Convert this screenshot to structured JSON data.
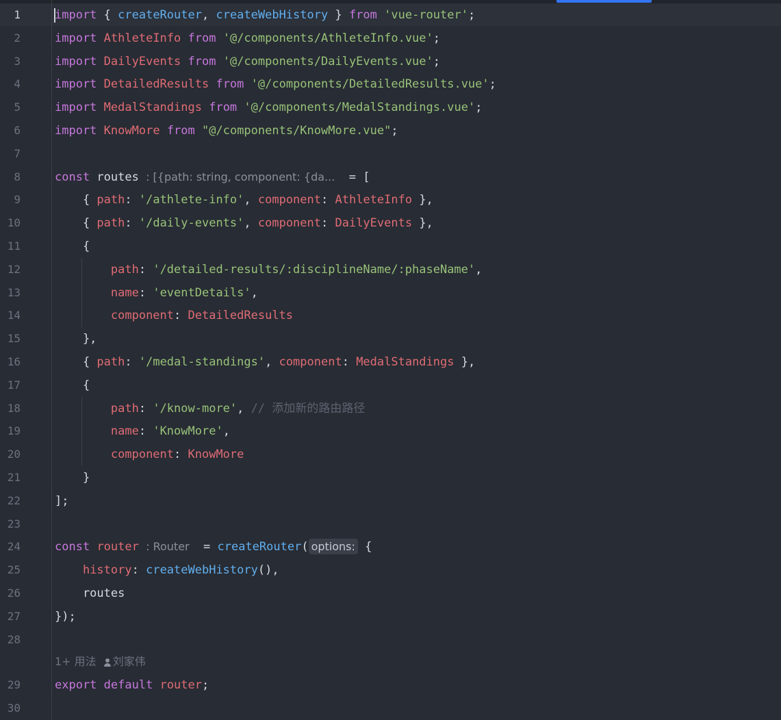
{
  "editor": {
    "lines": [
      {
        "n": "1",
        "tokens": [
          [
            "kw",
            "import"
          ],
          [
            "pun",
            " { "
          ],
          [
            "fn",
            "createRouter"
          ],
          [
            "pun",
            ", "
          ],
          [
            "fn",
            "createWebHistory"
          ],
          [
            "pun",
            " } "
          ],
          [
            "kw",
            "from"
          ],
          [
            "pun",
            " "
          ],
          [
            "str",
            "'vue-router'"
          ],
          [
            "pun",
            ";"
          ]
        ]
      },
      {
        "n": "2",
        "tokens": [
          [
            "kw",
            "import"
          ],
          [
            "pun",
            " "
          ],
          [
            "cls",
            "AthleteInfo"
          ],
          [
            "pun",
            " "
          ],
          [
            "kw",
            "from"
          ],
          [
            "pun",
            " "
          ],
          [
            "str",
            "'@/components/AthleteInfo.vue'"
          ],
          [
            "pun",
            ";"
          ]
        ]
      },
      {
        "n": "3",
        "tokens": [
          [
            "kw",
            "import"
          ],
          [
            "pun",
            " "
          ],
          [
            "cls",
            "DailyEvents"
          ],
          [
            "pun",
            " "
          ],
          [
            "kw",
            "from"
          ],
          [
            "pun",
            " "
          ],
          [
            "str",
            "'@/components/DailyEvents.vue'"
          ],
          [
            "pun",
            ";"
          ]
        ]
      },
      {
        "n": "4",
        "tokens": [
          [
            "kw",
            "import"
          ],
          [
            "pun",
            " "
          ],
          [
            "cls",
            "DetailedResults"
          ],
          [
            "pun",
            " "
          ],
          [
            "kw",
            "from"
          ],
          [
            "pun",
            " "
          ],
          [
            "str",
            "'@/components/DetailedResults.vue'"
          ],
          [
            "pun",
            ";"
          ]
        ]
      },
      {
        "n": "5",
        "tokens": [
          [
            "kw",
            "import"
          ],
          [
            "pun",
            " "
          ],
          [
            "cls",
            "MedalStandings"
          ],
          [
            "pun",
            " "
          ],
          [
            "kw",
            "from"
          ],
          [
            "pun",
            " "
          ],
          [
            "str",
            "'@/components/MedalStandings.vue'"
          ],
          [
            "pun",
            ";"
          ]
        ]
      },
      {
        "n": "6",
        "tokens": [
          [
            "kw",
            "import"
          ],
          [
            "pun",
            " "
          ],
          [
            "cls",
            "KnowMore"
          ],
          [
            "pun",
            " "
          ],
          [
            "kw",
            "from"
          ],
          [
            "pun",
            " "
          ],
          [
            "str",
            "\"@/components/KnowMore.vue\""
          ],
          [
            "pun",
            ";"
          ]
        ]
      },
      {
        "n": "7",
        "tokens": []
      },
      {
        "n": "8",
        "tokens": [
          [
            "kw",
            "const"
          ],
          [
            "var",
            " routes "
          ],
          [
            "hint",
            ": [{path: string, component: {da...  "
          ],
          [
            "pun",
            " = ["
          ]
        ]
      },
      {
        "n": "9",
        "tokens": [
          [
            "pun",
            "    { "
          ],
          [
            "prop",
            "path"
          ],
          [
            "pun",
            ": "
          ],
          [
            "str",
            "'/athlete-info'"
          ],
          [
            "pun",
            ", "
          ],
          [
            "prop",
            "component"
          ],
          [
            "pun",
            ": "
          ],
          [
            "cls",
            "AthleteInfo"
          ],
          [
            "pun",
            " },"
          ]
        ]
      },
      {
        "n": "10",
        "tokens": [
          [
            "pun",
            "    { "
          ],
          [
            "prop",
            "path"
          ],
          [
            "pun",
            ": "
          ],
          [
            "str",
            "'/daily-events'"
          ],
          [
            "pun",
            ", "
          ],
          [
            "prop",
            "component"
          ],
          [
            "pun",
            ": "
          ],
          [
            "cls",
            "DailyEvents"
          ],
          [
            "pun",
            " },"
          ]
        ]
      },
      {
        "n": "11",
        "tokens": [
          [
            "pun",
            "    {"
          ]
        ]
      },
      {
        "n": "12",
        "tokens": [
          [
            "pun",
            "        "
          ],
          [
            "prop",
            "path"
          ],
          [
            "pun",
            ": "
          ],
          [
            "str",
            "'/detailed-results/:disciplineName/:phaseName'"
          ],
          [
            "pun",
            ","
          ]
        ]
      },
      {
        "n": "13",
        "tokens": [
          [
            "pun",
            "        "
          ],
          [
            "prop",
            "name"
          ],
          [
            "pun",
            ": "
          ],
          [
            "str",
            "'eventDetails'"
          ],
          [
            "pun",
            ","
          ]
        ]
      },
      {
        "n": "14",
        "tokens": [
          [
            "pun",
            "        "
          ],
          [
            "prop",
            "component"
          ],
          [
            "pun",
            ": "
          ],
          [
            "cls",
            "DetailedResults"
          ]
        ]
      },
      {
        "n": "15",
        "tokens": [
          [
            "pun",
            "    },"
          ]
        ]
      },
      {
        "n": "16",
        "tokens": [
          [
            "pun",
            "    { "
          ],
          [
            "prop",
            "path"
          ],
          [
            "pun",
            ": "
          ],
          [
            "str",
            "'/medal-standings'"
          ],
          [
            "pun",
            ", "
          ],
          [
            "prop",
            "component"
          ],
          [
            "pun",
            ": "
          ],
          [
            "cls",
            "MedalStandings"
          ],
          [
            "pun",
            " },"
          ]
        ]
      },
      {
        "n": "17",
        "tokens": [
          [
            "pun",
            "    {"
          ]
        ]
      },
      {
        "n": "18",
        "tokens": [
          [
            "pun",
            "        "
          ],
          [
            "prop",
            "path"
          ],
          [
            "pun",
            ": "
          ],
          [
            "str",
            "'/know-more'"
          ],
          [
            "pun",
            ", "
          ],
          [
            "cmt",
            "// 添加新的路由路径"
          ]
        ]
      },
      {
        "n": "19",
        "tokens": [
          [
            "pun",
            "        "
          ],
          [
            "prop",
            "name"
          ],
          [
            "pun",
            ": "
          ],
          [
            "str",
            "'KnowMore'"
          ],
          [
            "pun",
            ","
          ]
        ]
      },
      {
        "n": "20",
        "tokens": [
          [
            "pun",
            "        "
          ],
          [
            "prop",
            "component"
          ],
          [
            "pun",
            ": "
          ],
          [
            "cls",
            "KnowMore"
          ]
        ]
      },
      {
        "n": "21",
        "tokens": [
          [
            "pun",
            "    }"
          ]
        ]
      },
      {
        "n": "22",
        "tokens": [
          [
            "pun",
            "];"
          ]
        ]
      },
      {
        "n": "23",
        "tokens": []
      },
      {
        "n": "24",
        "tokens": [
          [
            "kw",
            "const"
          ],
          [
            "pun",
            " "
          ],
          [
            "cls",
            "router"
          ],
          [
            "pun",
            " "
          ],
          [
            "hint",
            ": Router  "
          ],
          [
            "pun",
            " = "
          ],
          [
            "fn",
            "createRouter"
          ],
          [
            "pun",
            "("
          ],
          [
            "hintbox",
            "options:"
          ],
          [
            "pun",
            " {"
          ]
        ]
      },
      {
        "n": "25",
        "tokens": [
          [
            "pun",
            "    "
          ],
          [
            "prop",
            "history"
          ],
          [
            "pun",
            ": "
          ],
          [
            "fn",
            "createWebHistory"
          ],
          [
            "pun",
            "(),"
          ]
        ]
      },
      {
        "n": "26",
        "tokens": [
          [
            "pun",
            "    routes"
          ]
        ]
      },
      {
        "n": "27",
        "tokens": [
          [
            "pun",
            "});"
          ]
        ]
      },
      {
        "n": "28",
        "tokens": []
      },
      {
        "n": "29",
        "tokens": [
          [
            "kw",
            "export"
          ],
          [
            "pun",
            " "
          ],
          [
            "kw",
            "default"
          ],
          [
            "pun",
            " "
          ],
          [
            "cls",
            "router"
          ],
          [
            "pun",
            ";"
          ]
        ]
      },
      {
        "n": "30",
        "tokens": []
      }
    ]
  },
  "codelens": {
    "usages": "1+ 用法",
    "author": "刘家伟"
  },
  "colors": {
    "background": "#282c34",
    "keyword": "#c678dd",
    "function": "#61afef",
    "identifier": "#e06c75",
    "string": "#98c379",
    "comment": "#5c6370",
    "accent": "#3574f0"
  }
}
